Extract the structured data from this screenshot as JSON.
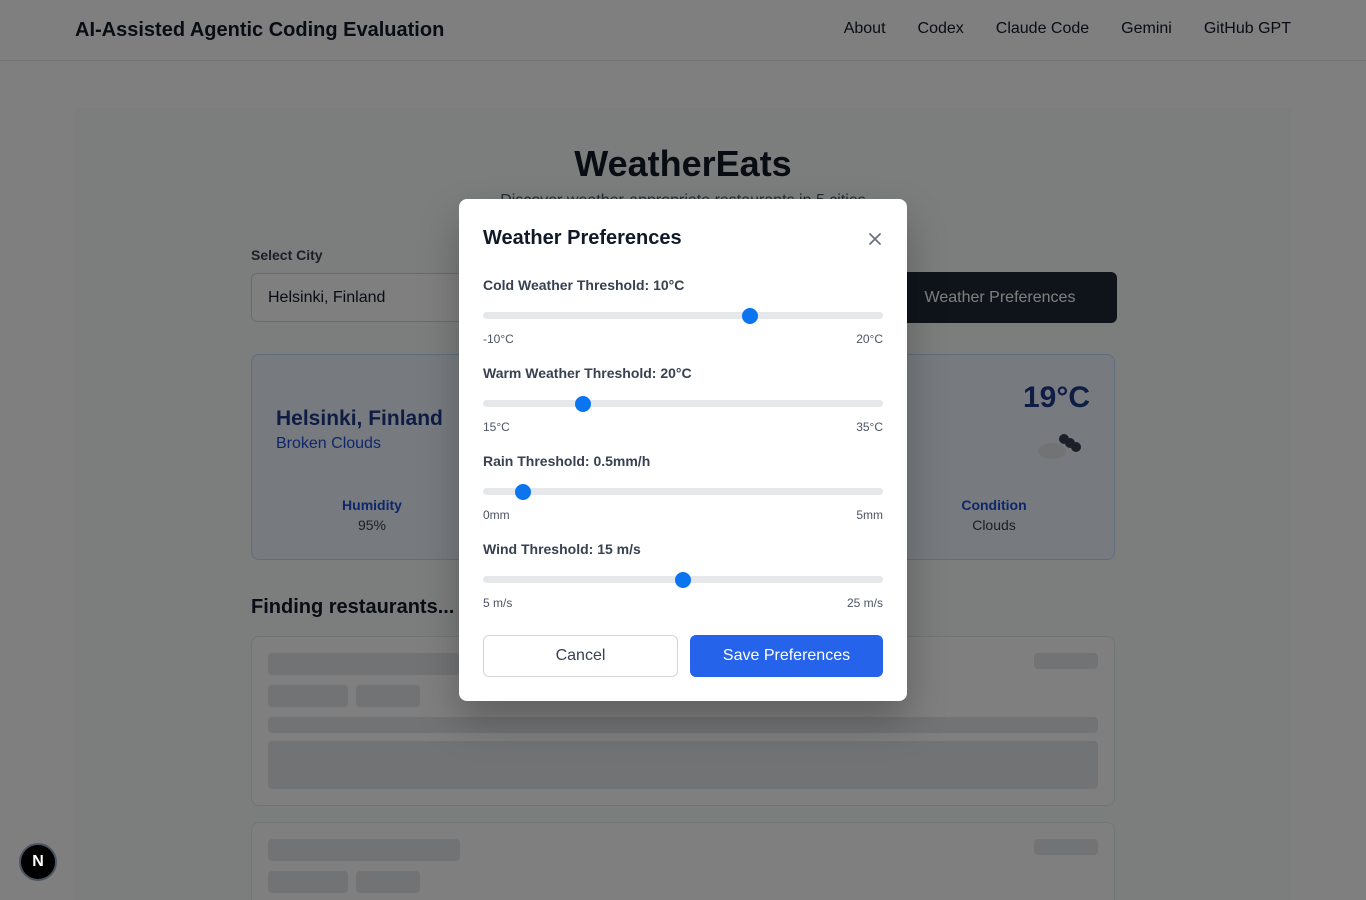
{
  "nav": {
    "brand": "AI-Assisted Agentic Coding Evaluation",
    "links": [
      "About",
      "Codex",
      "Claude Code",
      "Gemini",
      "GitHub GPT"
    ]
  },
  "hero": {
    "title": "WeatherEats",
    "subtitle": "Discover weather-appropriate restaurants in 5 cities"
  },
  "city_select": {
    "label": "Select City",
    "value": "Helsinki, Finland"
  },
  "preferences_button": {
    "label": "Weather Preferences"
  },
  "weather": {
    "city": "Helsinki, Finland",
    "description": "Broken Clouds",
    "temperature": "19°C",
    "icon": "broken-clouds-icon",
    "humidity_label": "Humidity",
    "humidity_value": "95%",
    "condition_label": "Condition",
    "condition_value": "Clouds"
  },
  "finding": "Finding restaurants...",
  "modal": {
    "title": "Weather Preferences",
    "close_icon": "close-icon",
    "sliders": [
      {
        "label": "Cold Weather Threshold: 10°C",
        "min_label": "-10°C",
        "max_label": "20°C",
        "min": -10,
        "max": 20,
        "value": 10
      },
      {
        "label": "Warm Weather Threshold: 20°C",
        "min_label": "15°C",
        "max_label": "35°C",
        "min": 15,
        "max": 35,
        "value": 20
      },
      {
        "label": "Rain Threshold: 0.5mm/h",
        "min_label": "0mm",
        "max_label": "5mm",
        "min": 0,
        "max": 5,
        "value": 0.5
      },
      {
        "label": "Wind Threshold: 15 m/s",
        "min_label": "5 m/s",
        "max_label": "25 m/s",
        "min": 5,
        "max": 25,
        "value": 15
      }
    ],
    "cancel_label": "Cancel",
    "save_label": "Save Preferences"
  },
  "badge": {
    "letter": "N"
  },
  "colors": {
    "primary": "#2563eb",
    "slider_thumb": "#0b75f0",
    "dark_button": "#1f2937",
    "weather_card_bg": "#eff6ff"
  }
}
